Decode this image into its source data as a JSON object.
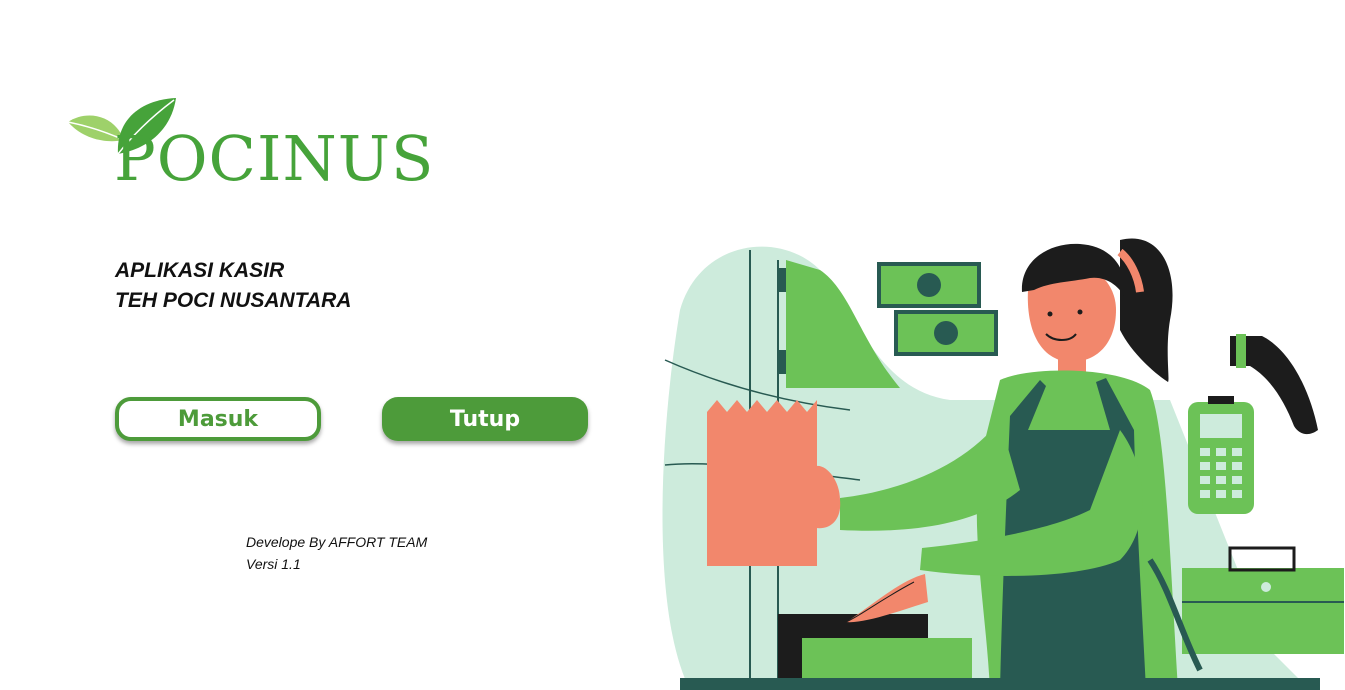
{
  "logo": {
    "text": "POCINUS",
    "icon": "leaf-icon"
  },
  "tagline": {
    "line1": "APLIKASI KASIR",
    "line2": "TEH POCI NUSANTARA"
  },
  "buttons": {
    "masuk_label": "Masuk",
    "tutup_label": "Tutup"
  },
  "credits": {
    "developer": "Develope By AFFORT TEAM",
    "version": "Versi 1.1"
  },
  "colors": {
    "brand_green": "#4d9b3a",
    "illustration_green": "#6cc257",
    "dark_teal": "#285a52",
    "mint_background": "#cdebdc",
    "salmon": "#f2876c"
  }
}
